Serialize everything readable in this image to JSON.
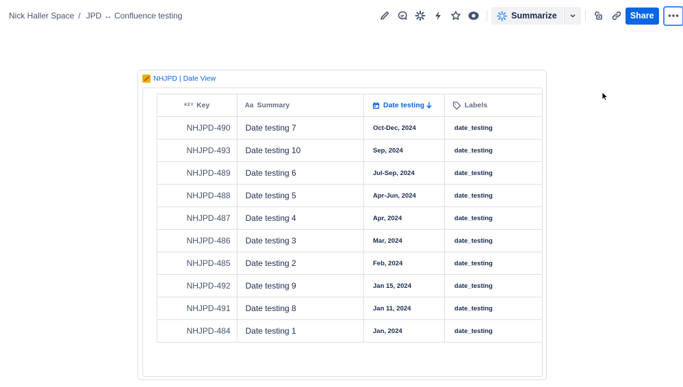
{
  "breadcrumb": {
    "space": "Nick Haller Space",
    "separator": "/",
    "page": "JPD ↔ Confluence testing"
  },
  "toolbar": {
    "summarize_label": "Summarize",
    "share_label": "Share",
    "icons": [
      "edit-icon",
      "comment-icon",
      "loom-icon",
      "automation-icon",
      "star-icon",
      "watch-icon",
      "restrictions-icon",
      "link-icon",
      "more-icon"
    ]
  },
  "macro": {
    "title": "NHJPD | Date View",
    "columns": {
      "key_tag": "KEY",
      "key": "Key",
      "summary_tag": "Aa",
      "summary": "Summary",
      "date": "Date testing",
      "labels": "Labels"
    },
    "rows": [
      {
        "key": "NHJPD-490",
        "summary": "Date testing 7",
        "date": "Oct-Dec, 2024",
        "label": "date_testing"
      },
      {
        "key": "NHJPD-493",
        "summary": "Date testing 10",
        "date": "Sep, 2024",
        "label": "date_testing"
      },
      {
        "key": "NHJPD-489",
        "summary": "Date testing 6",
        "date": "Jul-Sep, 2024",
        "label": "date_testing"
      },
      {
        "key": "NHJPD-488",
        "summary": "Date testing 5",
        "date": "Apr-Jun, 2024",
        "label": "date_testing"
      },
      {
        "key": "NHJPD-487",
        "summary": "Date testing 4",
        "date": "Apr, 2024",
        "label": "date_testing"
      },
      {
        "key": "NHJPD-486",
        "summary": "Date testing 3",
        "date": "Mar, 2024",
        "label": "date_testing"
      },
      {
        "key": "NHJPD-485",
        "summary": "Date testing 2",
        "date": "Feb, 2024",
        "label": "date_testing"
      },
      {
        "key": "NHJPD-492",
        "summary": "Date testing 9",
        "date": "Jan 15, 2024",
        "label": "date_testing"
      },
      {
        "key": "NHJPD-491",
        "summary": "Date testing 8",
        "date": "Jan 11, 2024",
        "label": "date_testing"
      },
      {
        "key": "NHJPD-484",
        "summary": "Date testing 1",
        "date": "Jan, 2024",
        "label": "date_testing"
      }
    ]
  },
  "colors": {
    "primary": "#0c66e4",
    "text": "#172b4d",
    "subtle": "#626f86",
    "border": "#dcdfe4"
  }
}
